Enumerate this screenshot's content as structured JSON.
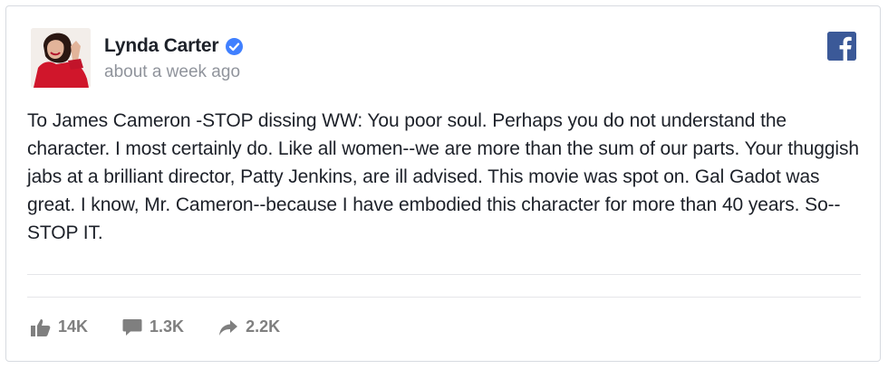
{
  "post": {
    "author": "Lynda Carter",
    "timestamp": "about a week ago",
    "text": "To James Cameron -STOP dissing WW: You poor soul. Perhaps you do not understand the character. I most certainly do. Like all women--we are more than the sum of our parts. Your thuggish jabs at a brilliant director, Patty Jenkins, are ill advised. This movie was spot on. Gal Gadot was great. I know, Mr. Cameron--because I have embodied this character for more than 40 years. So--STOP IT."
  },
  "stats": {
    "likes": "14K",
    "comments": "1.3K",
    "shares": "2.2K"
  },
  "colors": {
    "brand": "#3b5998",
    "verified": "#4080ff",
    "muted": "#7f7f7f"
  },
  "icons": [
    "avatar",
    "verified-badge-icon",
    "facebook-logo-icon",
    "like-icon",
    "comment-icon",
    "share-icon"
  ]
}
